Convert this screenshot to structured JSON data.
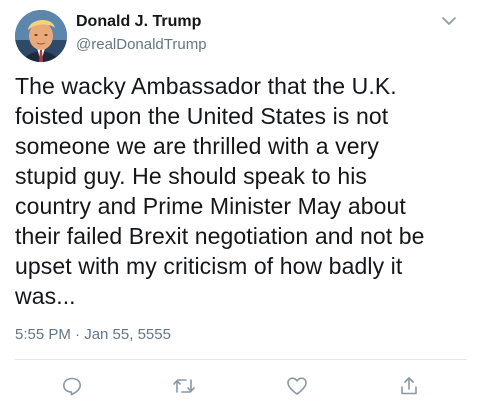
{
  "tweet": {
    "author": {
      "display_name": "Donald J. Trump",
      "handle": "@realDonaldTrump"
    },
    "text_lines": [
      "The wacky Ambassador that the U.K.",
      "foisted upon the United States is not",
      "someone we are thrilled with a very",
      "stupid guy. He should speak to his",
      "country and Prime Minister May about",
      "their failed Brexit negotiation and not be",
      "upset with my criticism of how badly it",
      "was..."
    ],
    "timestamp": "5:55 PM · Jan 55, 5555",
    "actions": [
      "reply-icon",
      "retweet-icon",
      "like-icon",
      "share-icon"
    ],
    "colors": {
      "text": "#14171a",
      "secondary": "#657786",
      "divider": "#e1e8ed"
    }
  }
}
